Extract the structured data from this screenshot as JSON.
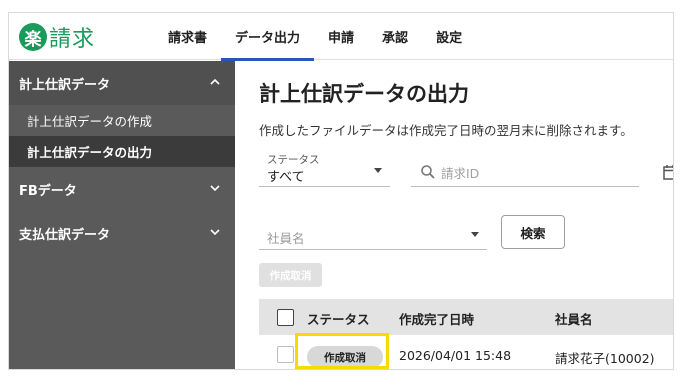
{
  "header": {
    "logo_mark": "楽",
    "logo_text": "楽請求",
    "nav": [
      {
        "label": "請求書"
      },
      {
        "label": "データ出力"
      },
      {
        "label": "申請"
      },
      {
        "label": "承認"
      },
      {
        "label": "設定"
      }
    ],
    "active_nav": "データ出力"
  },
  "sidebar": {
    "sections": [
      {
        "label": "計上仕訳データ",
        "expanded": true,
        "items": [
          {
            "label": "計上仕訳データの作成"
          },
          {
            "label": "計上仕訳データの出力"
          }
        ]
      },
      {
        "label": "FBデータ",
        "expanded": false
      },
      {
        "label": "支払仕訳データ",
        "expanded": false
      }
    ],
    "active_item": "計上仕訳データの出力"
  },
  "main": {
    "title": "計上仕訳データの出力",
    "description": "作成したファイルデータは作成完了日時の翌月末に削除されます。",
    "status_filter": {
      "label": "ステータス",
      "value": "すべて"
    },
    "search": {
      "placeholder": "請求ID"
    },
    "employee_filter": {
      "placeholder": "社員名"
    },
    "search_button": "検索",
    "cancel_button": "作成取消",
    "table": {
      "columns": [
        "ステータス",
        "作成完了日時",
        "社員名"
      ],
      "rows": [
        {
          "status": "作成取消",
          "completed_at": "2026/04/01 15:48",
          "employee": "請求花子(10002)"
        }
      ]
    }
  },
  "colors": {
    "brand": "#1a9a5b",
    "active_tab_underline": "#2a56b8",
    "sidebar_bg": "#5a5a5a",
    "highlight": "#f5dc00"
  }
}
